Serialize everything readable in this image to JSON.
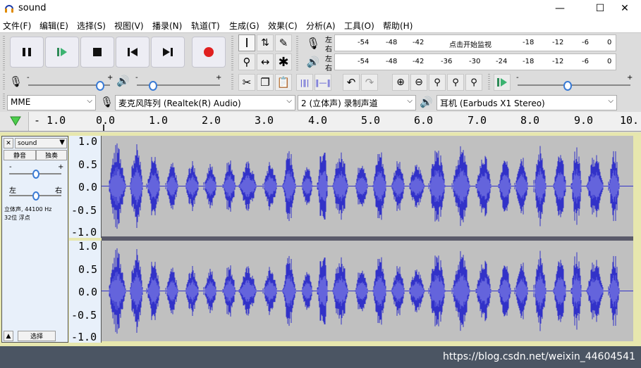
{
  "window": {
    "title": "sound",
    "minimize": "—",
    "maximize": "☐",
    "close": "✕"
  },
  "menu": [
    "文件(F)",
    "编辑(E)",
    "选择(S)",
    "视图(V)",
    "播录(N)",
    "轨道(T)",
    "生成(G)",
    "效果(C)",
    "分析(A)",
    "工具(O)",
    "帮助(H)"
  ],
  "meters": {
    "record_ticks": [
      "-54",
      "-48",
      "-42",
      "点击开始监视",
      "-18",
      "-12",
      "-6",
      "0"
    ],
    "play_ticks": [
      "-54",
      "-48",
      "-42",
      "-36",
      "-30",
      "-24",
      "-18",
      "-12",
      "-6",
      "0"
    ],
    "left": "左",
    "right": "右"
  },
  "mixer": {
    "minus": "-",
    "plus": "+"
  },
  "devices": {
    "host": "MME",
    "mic": "麦克风阵列 (Realtek(R) Audio)",
    "channels": "2 (立体声) 录制声道",
    "output": "耳机 (Earbuds X1 Stereo)"
  },
  "ruler": [
    "- 1.0",
    "0.0",
    "1.0",
    "2.0",
    "3.0",
    "4.0",
    "5.0",
    "6.0",
    "7.0",
    "8.0",
    "9.0",
    "10."
  ],
  "track": {
    "name": "sound",
    "mute": "静音",
    "solo": "独奏",
    "gain_minus": "-",
    "gain_plus": "+",
    "pan_left": "左",
    "pan_right": "右",
    "info1": "立体声, 44100 Hz",
    "info2": "32位 浮点",
    "select": "选择",
    "scale": [
      "1.0",
      "0.5",
      "0.0",
      "-0.5",
      "-1.0"
    ]
  },
  "watermark": "https://blog.csdn.net/weixin_44604541",
  "colors": {
    "waveform": "#3232c8",
    "waveform_rms": "#6464dc",
    "track_bg": "#c0c0c0",
    "play_green": "#3cb371",
    "record_red": "#e02020"
  }
}
